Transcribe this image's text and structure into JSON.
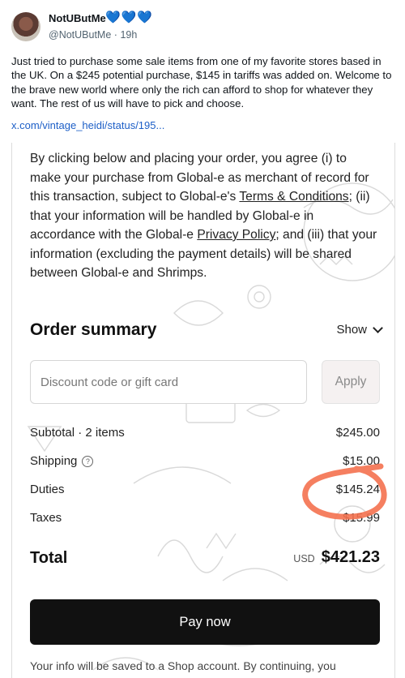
{
  "post": {
    "author_name": "NotUButMe",
    "handle": "@NotUButMe",
    "separator": "·",
    "time": "19h",
    "hearts": [
      "💙",
      "💙",
      "💙"
    ],
    "text": "Just tried to purchase some sale items from one of my favorite stores based in the UK. On a $245 potential purchase, $145 in tariffs was added on. Welcome to the brave new world where only the rich can afford to shop for whatever they want. The rest of us will have to pick and choose.",
    "link": "x.com/vintage_heidi/status/195..."
  },
  "checkout": {
    "legal": {
      "part1": "By clicking below and placing your order, you agree (i) to make your purchase from Global-e as merchant of record for this transaction, subject to Global-e's ",
      "terms_link": "Terms & Conditions",
      "part2": "; (ii) that your information will be handled by Global-e in accordance with the Global-e ",
      "privacy_link": "Privacy Policy",
      "part3": "; and (iii) that your information (excluding the payment details) will be shared between Global-e and Shrimps."
    },
    "order_summary_title": "Order summary",
    "show_label": "Show",
    "discount_placeholder": "Discount code or gift card",
    "apply_label": "Apply",
    "lines": [
      {
        "label": "Subtotal · 2 items",
        "value": "$245.00"
      },
      {
        "label": "Shipping",
        "value": "$15.00",
        "help": true
      },
      {
        "label": "Duties",
        "value": "$145.24"
      },
      {
        "label": "Taxes",
        "value": "$15.99"
      }
    ],
    "total_label": "Total",
    "currency": "USD",
    "total_value": "$421.23",
    "pay_label": "Pay now",
    "footnote": "Your info will be saved to a Shop account. By continuing, you"
  },
  "colors": {
    "heart": "#1d6fe0",
    "link": "#1d5fc7",
    "pay_button": "#111111",
    "annotation": "#f4714f"
  }
}
